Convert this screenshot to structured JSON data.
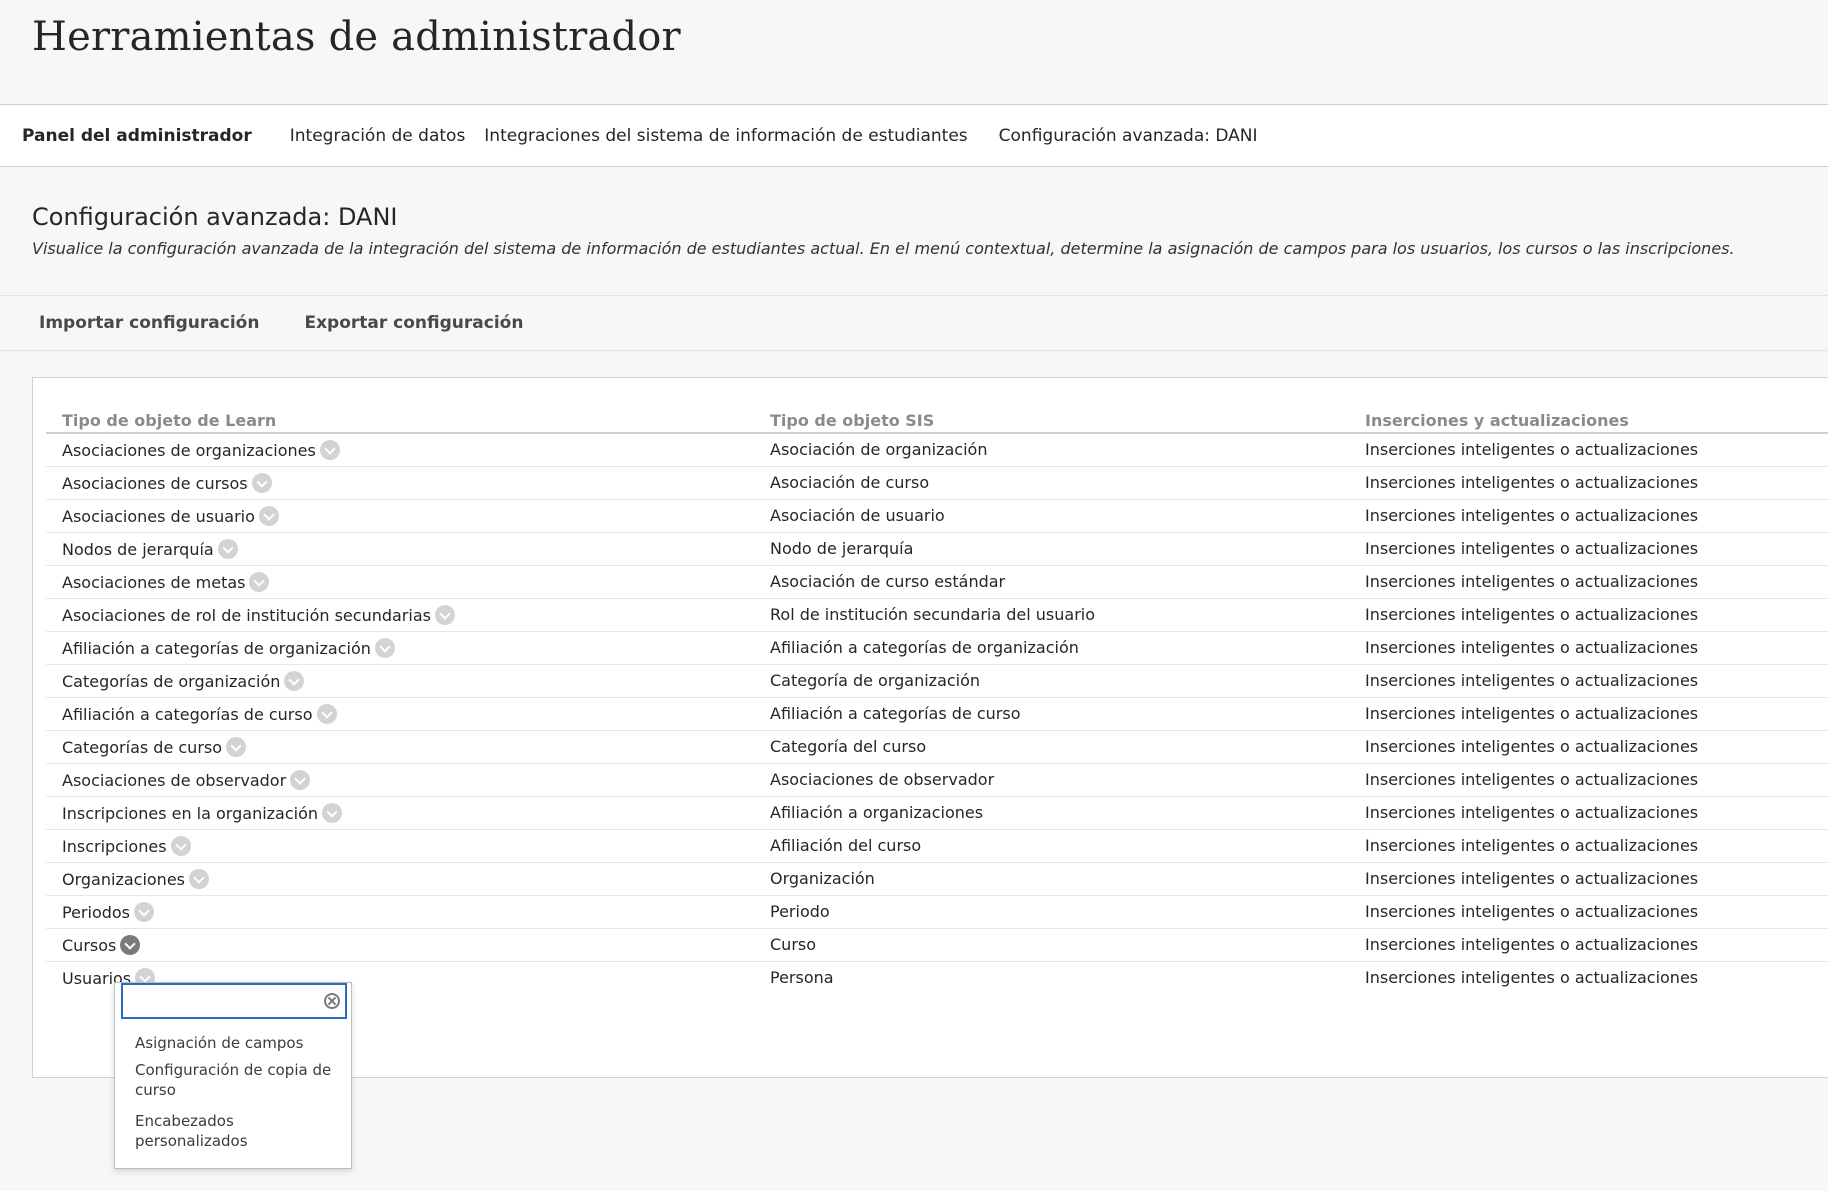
{
  "app": {
    "title": "Herramientas de administrador"
  },
  "breadcrumb": [
    "Panel del administrador",
    "Integración de datos",
    "Integraciones del sistema de información de estudiantes",
    "Configuración avanzada: DANI"
  ],
  "page": {
    "title": "Configuración avanzada: DANI",
    "description": "Visualice la configuración avanzada de la integración del sistema de información de estudiantes actual. En el menú contextual, determine la asignación de campos para los usuarios, los cursos o las inscripciones."
  },
  "toolbar": {
    "import_label": "Importar configuración",
    "export_label": "Exportar configuración"
  },
  "table": {
    "headers": [
      "Tipo de objeto de Learn",
      "Tipo de objeto SIS",
      "Inserciones y actualizaciones"
    ],
    "rows": [
      [
        "Asociaciones de organizaciones",
        "Asociación de organización",
        "Inserciones inteligentes o actualizaciones"
      ],
      [
        "Asociaciones de cursos",
        "Asociación de curso",
        "Inserciones inteligentes o actualizaciones"
      ],
      [
        "Asociaciones de usuario",
        "Asociación de usuario",
        "Inserciones inteligentes o actualizaciones"
      ],
      [
        "Nodos de jerarquía",
        "Nodo de jerarquía",
        "Inserciones inteligentes o actualizaciones"
      ],
      [
        "Asociaciones de metas",
        "Asociación de curso estándar",
        "Inserciones inteligentes o actualizaciones"
      ],
      [
        "Asociaciones de rol de institución secundarias",
        "Rol de institución secundaria del usuario",
        "Inserciones inteligentes o actualizaciones"
      ],
      [
        "Afiliación a categorías de organización",
        "Afiliación a categorías de organización",
        "Inserciones inteligentes o actualizaciones"
      ],
      [
        "Categorías de organización",
        "Categoría de organización",
        "Inserciones inteligentes o actualizaciones"
      ],
      [
        "Afiliación a categorías de curso",
        "Afiliación a categorías de curso",
        "Inserciones inteligentes o actualizaciones"
      ],
      [
        "Categorías de curso",
        "Categoría del curso",
        "Inserciones inteligentes o actualizaciones"
      ],
      [
        "Asociaciones de observador",
        "Asociaciones de observador",
        "Inserciones inteligentes o actualizaciones"
      ],
      [
        "Inscripciones en la organización",
        "Afiliación a organizaciones",
        "Inserciones inteligentes o actualizaciones"
      ],
      [
        "Inscripciones",
        "Afiliación del curso",
        "Inserciones inteligentes o actualizaciones"
      ],
      [
        "Organizaciones",
        "Organización",
        "Inserciones inteligentes o actualizaciones"
      ],
      [
        "Periodos",
        "Periodo",
        "Inserciones inteligentes o actualizaciones"
      ],
      [
        "Cursos",
        "Curso",
        "Inserciones inteligentes o actualizaciones"
      ],
      [
        "Usuarios",
        "Persona",
        "Inserciones inteligentes o actualizaciones"
      ]
    ],
    "active_row": 15
  },
  "context_menu": {
    "search_value": "",
    "clear_icon": "clear-icon",
    "items": [
      "Asignación de campos",
      "Configuración de copia de curso",
      "Encabezados personalizados"
    ]
  },
  "colors": {
    "focus_border": "#2a6ebb",
    "background": "#f7f7f7"
  }
}
